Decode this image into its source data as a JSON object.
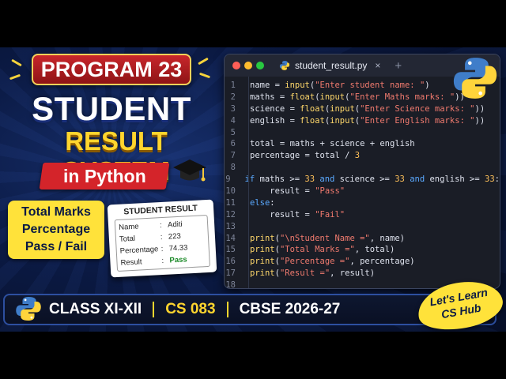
{
  "badge": {
    "label": "PROGRAM 23"
  },
  "title": {
    "line1": "STUDENT",
    "line2": "RESULT SYSTEM",
    "banner": "in Python"
  },
  "features": [
    "Total Marks",
    "Percentage",
    "Pass / Fail"
  ],
  "result_card": {
    "title": "STUDENT RESULT",
    "rows": [
      {
        "key": "Name",
        "value": "Aditi"
      },
      {
        "key": "Total",
        "value": "223"
      },
      {
        "key": "Percentage",
        "value": "74.33"
      },
      {
        "key": "Result",
        "value": "Pass"
      }
    ]
  },
  "editor": {
    "tab_name": "student_result.py",
    "close_glyph": "×",
    "add_glyph": "+",
    "line_numbers": [
      "1",
      "2",
      "3",
      "4",
      "5",
      "6",
      "7",
      "8",
      "9",
      "10",
      "11",
      "12",
      "13",
      "14",
      "15",
      "16",
      "17",
      "18"
    ]
  },
  "bottom": {
    "class_label": "CLASS XI-XII",
    "subject_code": "CS 083",
    "board": "CBSE 2026-27"
  },
  "hub": {
    "line1": "Let's Learn",
    "line2": "CS Hub"
  },
  "colors": {
    "accent_yellow": "#ffd52e",
    "accent_red": "#d4242a",
    "bg_navy": "#0b1a44",
    "pass_green": "#1c8a28"
  }
}
